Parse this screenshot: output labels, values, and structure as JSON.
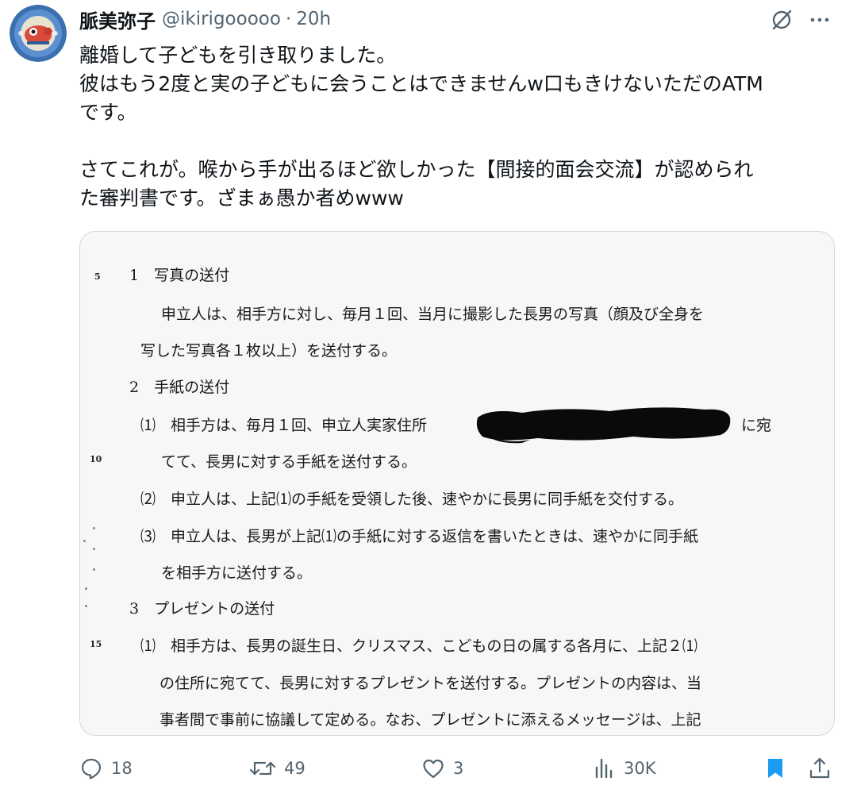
{
  "author": {
    "display_name": "脈美弥子",
    "handle": "@ikirigooooo",
    "separator": "·",
    "time": "20h"
  },
  "header_icons": [
    "grok-icon",
    "more-icon"
  ],
  "tweet": {
    "lines": [
      "離婚して子どもを引き取りました。",
      "彼はもう2度と実の子どもに会うことはできませんw口もきけないただのATM",
      "です。",
      "",
      "さてこれが。喉から手が出るほど欲しかった【間接的面会交流】が認められ",
      "た審判書です。ざまぁ愚か者めwww"
    ]
  },
  "document": {
    "line_numbers": [
      "5",
      "10",
      "15"
    ],
    "lines": [
      "1　写真の送付",
      "申立人は、相手方に対し、毎月１回、当月に撮影した長男の写真（顔及び全身を",
      "写した写真各１枚以上）を送付する。",
      "2　手紙の送付",
      "⑴　相手方は、毎月１回、申立人実家住所",
      "に宛",
      "てて、長男に対する手紙を送付する。",
      "⑵　申立人は、上記⑴の手紙を受領した後、速やかに長男に同手紙を交付する。",
      "⑶　申立人は、長男が上記⑴の手紙に対する返信を書いたときは、速やかに同手紙",
      "を相手方に送付する。",
      "3　プレゼントの送付",
      "⑴　相手方は、長男の誕生日、クリスマス、こどもの日の属する各月に、上記２⑴",
      "の住所に宛てて、長男に対するプレゼントを送付する。プレゼントの内容は、当",
      "事者間で事前に協議して定める。なお、プレゼントに添えるメッセージは、上記"
    ]
  },
  "actions": {
    "replies": "18",
    "reposts": "49",
    "likes": "3",
    "views": "30K"
  },
  "colors": {
    "text": "#0f1419",
    "secondary": "#536471",
    "bookmark_active": "#1d9bf0",
    "border": "#cfd9de"
  }
}
